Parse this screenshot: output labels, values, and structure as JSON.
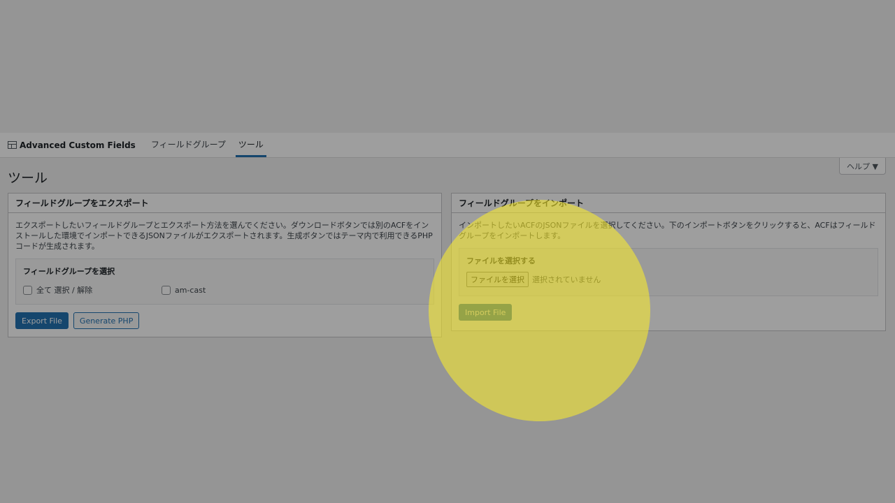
{
  "nav": {
    "brand": "Advanced Custom Fields",
    "tabs": [
      {
        "label": "フィールドグループ",
        "active": false
      },
      {
        "label": "ツール",
        "active": true
      }
    ],
    "help": "ヘルプ ▼"
  },
  "page": {
    "title": "ツール"
  },
  "export": {
    "heading": "フィールドグループをエクスポート",
    "description": "エクスポートしたいフィールドグループとエクスポート方法を選んでください。ダウンロードボタンでは別のACFをインストールした環境でインポートできるJSONファイルがエクスポートされます。生成ボタンではテーマ内で利用できるPHPコードが生成されます。",
    "select_title": "フィールドグループを選択",
    "options": [
      {
        "label": "全て 選択 / 解除",
        "checked": false
      },
      {
        "label": "am-cast",
        "checked": false
      }
    ],
    "export_button": "Export File",
    "generate_button": "Generate PHP"
  },
  "import": {
    "heading": "フィールドグループをインポート",
    "description": "インポートしたいACFのJSONファイルを選択してください。下のインポートボタンをクリックすると、ACFはフィールドグループをインポートします。",
    "file_title": "ファイルを選択する",
    "file_button": "ファイルを選択",
    "file_status": "選択されていません",
    "import_button": "Import File"
  },
  "colors": {
    "accent": "#2271b1",
    "highlight": "#fff028"
  }
}
